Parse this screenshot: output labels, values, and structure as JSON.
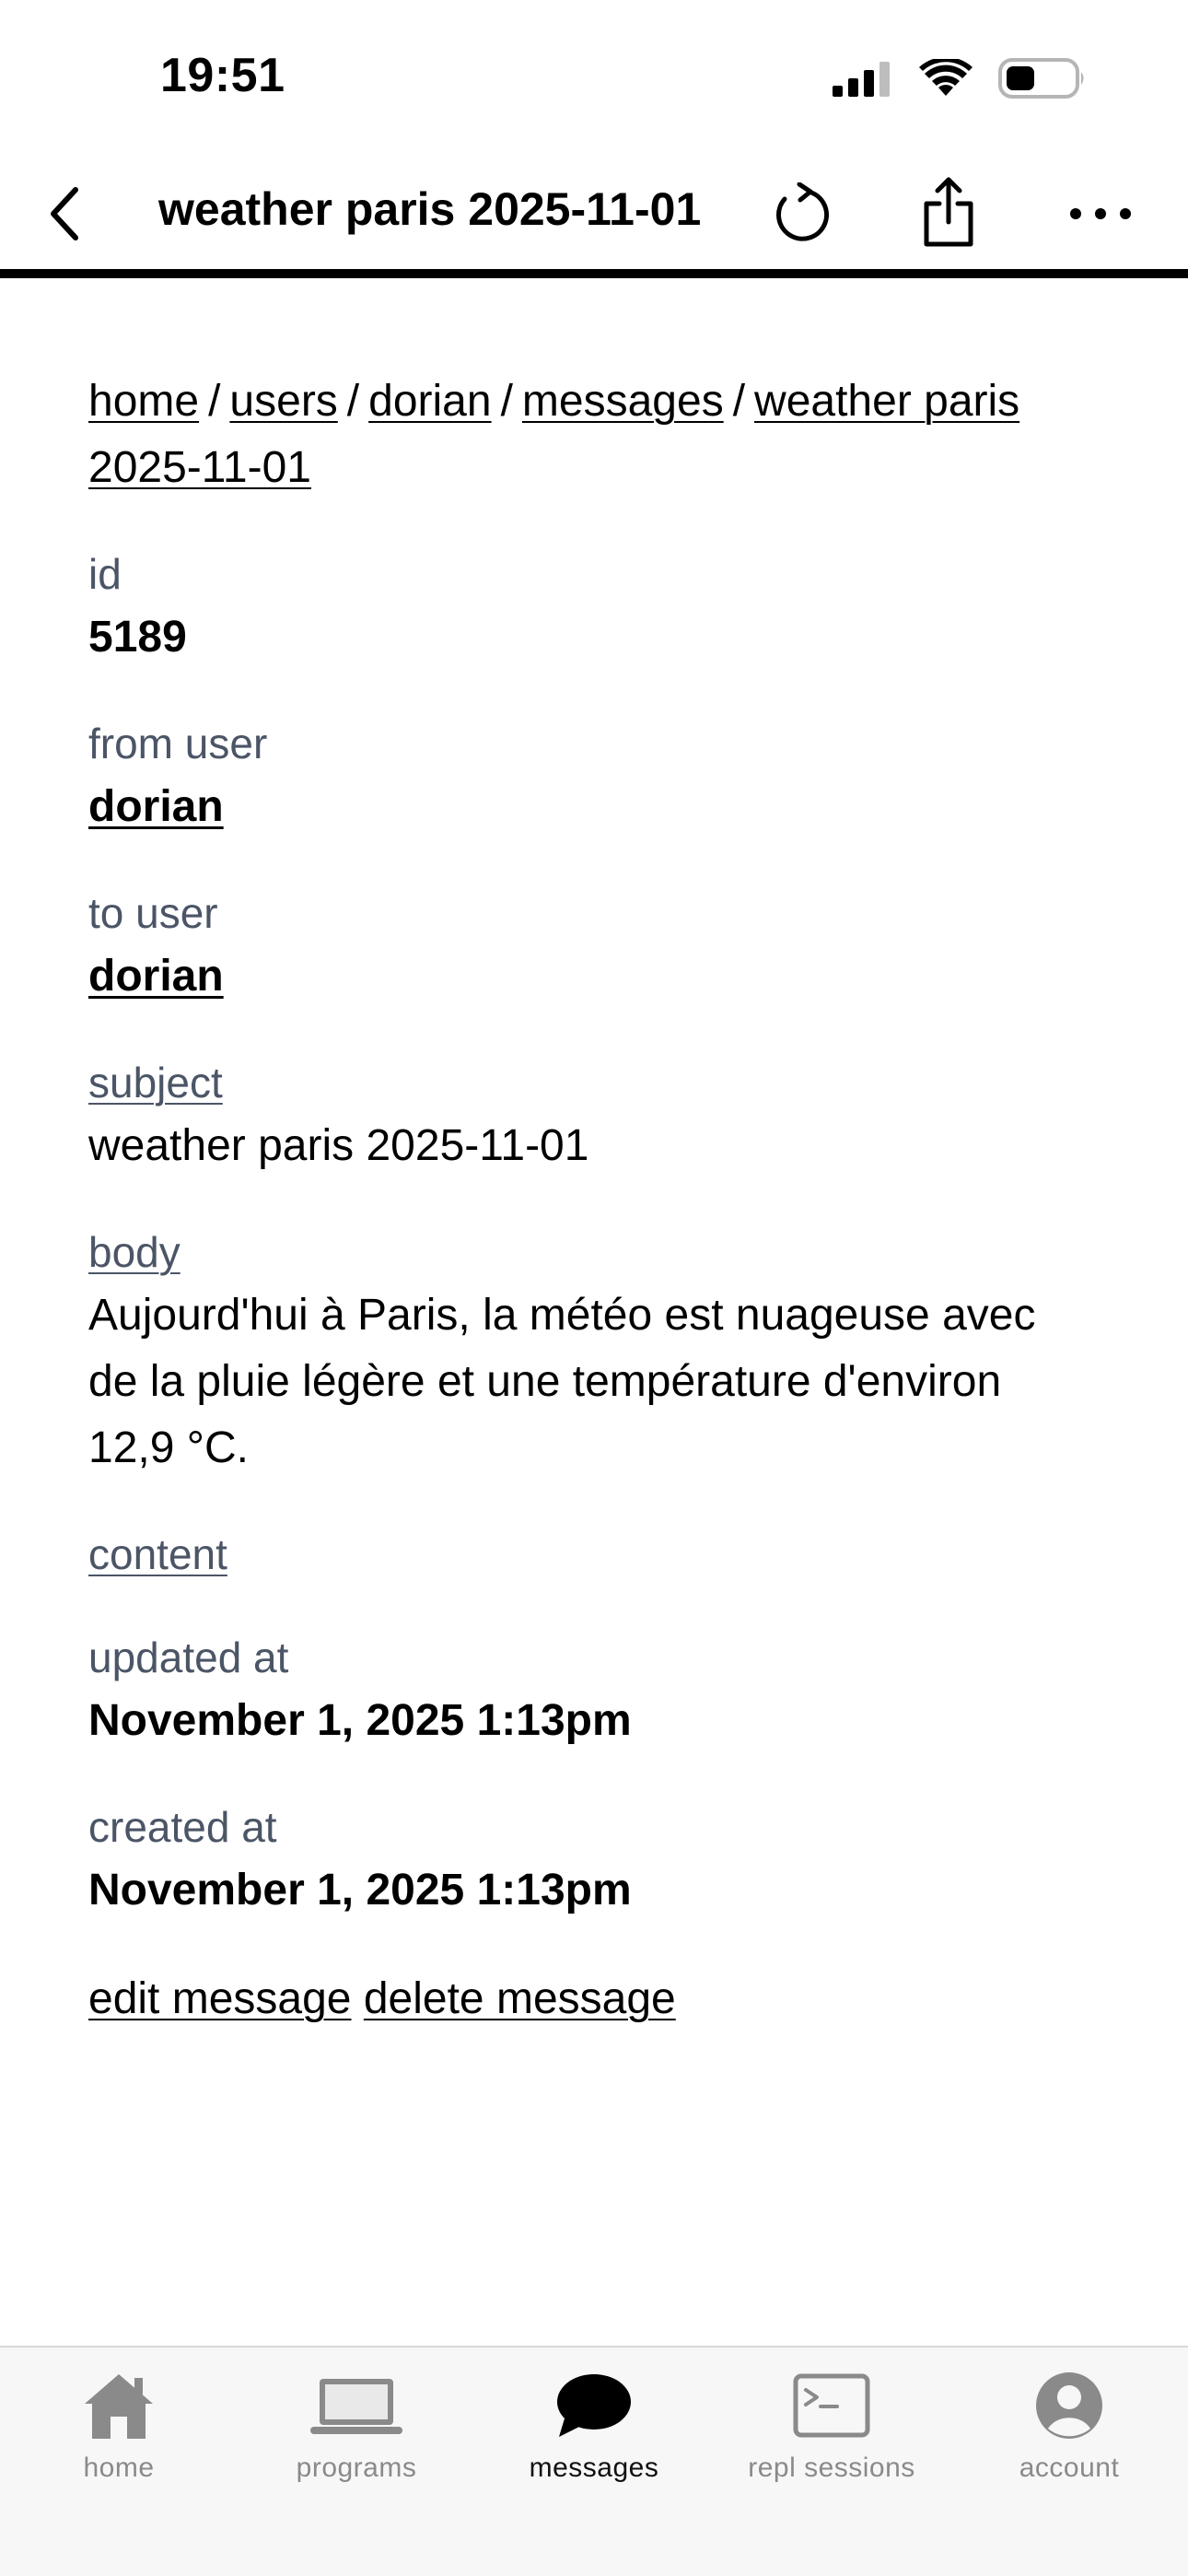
{
  "status_bar": {
    "time": "19:51"
  },
  "nav": {
    "title": "weather paris 2025-11-01"
  },
  "breadcrumb": {
    "items": [
      "home",
      "users",
      "dorian",
      "messages",
      "weather paris 2025-11-01"
    ],
    "separator": "/"
  },
  "fields": {
    "id": {
      "label": "id",
      "value": "5189"
    },
    "from_user": {
      "label": "from user",
      "value": "dorian"
    },
    "to_user": {
      "label": "to user",
      "value": "dorian"
    },
    "subject": {
      "label": "subject",
      "value": "weather paris 2025-11-01"
    },
    "body": {
      "label": "body",
      "value": "Aujourd'hui à Paris, la météo est nuageuse avec de la pluie légère et une température d'environ 12,9 °C."
    },
    "content": {
      "label": "content"
    },
    "updated_at": {
      "label": "updated at",
      "value": "November 1, 2025 1:13pm"
    },
    "created_at": {
      "label": "created at",
      "value": "November 1, 2025 1:13pm"
    }
  },
  "actions": {
    "edit": "edit message",
    "delete": "delete message"
  },
  "tab_bar": {
    "active": "messages",
    "tabs": [
      {
        "label": "home",
        "icon": "house-icon"
      },
      {
        "label": "programs",
        "icon": "laptop-icon"
      },
      {
        "label": "messages",
        "icon": "chat-bubble-icon"
      },
      {
        "label": "repl sessions",
        "icon": "terminal-icon"
      },
      {
        "label": "account",
        "icon": "person-circle-icon"
      }
    ]
  },
  "colors": {
    "label_gray": "#4b5566",
    "tab_inactive": "#8a8a8a",
    "tab_bar_bg": "#f7f7f7",
    "text": "#000000"
  }
}
